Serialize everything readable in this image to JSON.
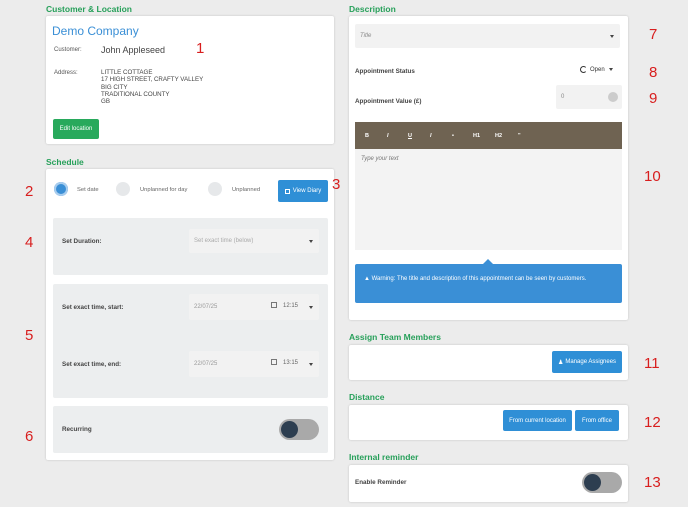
{
  "customer": {
    "section_title": "Customer & Location",
    "company": "Demo Company",
    "customer_label": "Customer:",
    "customer_name": "John Appleseed",
    "address_label": "Address:",
    "address_lines": [
      "LITTLE COTTAGE",
      "17 HIGH STREET, CRAFTY VALLEY",
      "BIG CITY",
      "TRADITIONAL COUNTY",
      "GB"
    ],
    "edit_button": "Edit location"
  },
  "schedule": {
    "section_title": "Schedule",
    "options": [
      "Set date",
      "Unplanned for day",
      "Unplanned"
    ],
    "view_diary": "View Diary",
    "duration_label": "Set Duration:",
    "duration_placeholder": "Set exact time (below)",
    "start_label": "Set exact time, start:",
    "start_date": "22/07/25",
    "start_time": "12:15",
    "end_label": "Set exact time, end:",
    "end_date": "22/07/25",
    "end_time": "13:15",
    "recurring_label": "Recurring"
  },
  "description": {
    "section_title": "Description",
    "title_placeholder": "Title",
    "status_label": "Appointment Status",
    "status_value": "Open",
    "value_label": "Appointment Value (£)",
    "value": "0",
    "toolbar": [
      "B",
      "I",
      "U",
      "I",
      "•",
      "H1",
      "H2",
      "\""
    ],
    "text_placeholder": "Type your text",
    "warning": "Warning: The title and description of this appointment can be seen by customers."
  },
  "team": {
    "section_title": "Assign Team Members",
    "manage_button": "Manage Assignees"
  },
  "distance": {
    "section_title": "Distance",
    "from_location": "From current location",
    "from_office": "From office"
  },
  "reminder": {
    "section_title": "Internal reminder",
    "enable_label": "Enable Reminder"
  },
  "markers": [
    "1",
    "2",
    "3",
    "4",
    "5",
    "6",
    "7",
    "8",
    "9",
    "10",
    "11",
    "12",
    "13"
  ]
}
